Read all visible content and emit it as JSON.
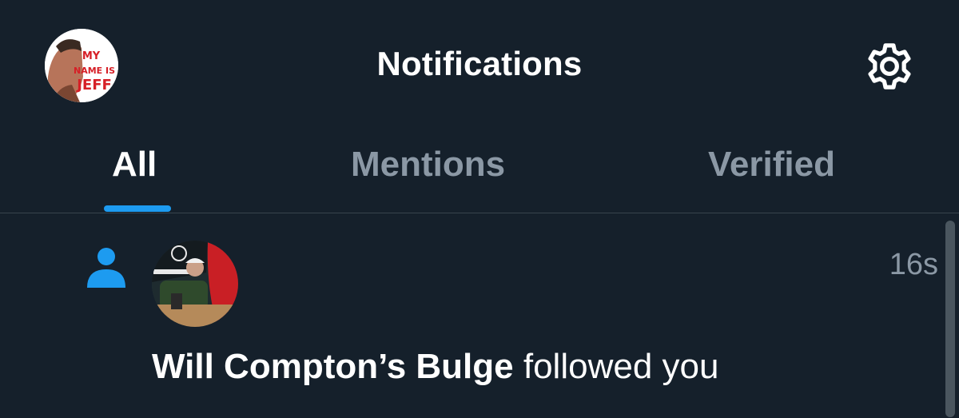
{
  "header": {
    "title": "Notifications",
    "avatar_icon": "profile-avatar",
    "avatar_text": [
      "MY",
      "NAME IS",
      "JEFF"
    ],
    "settings_icon": "gear-icon"
  },
  "tabs": [
    {
      "label": "All",
      "active": true
    },
    {
      "label": "Mentions",
      "active": false
    },
    {
      "label": "Verified",
      "active": false
    }
  ],
  "notifications": [
    {
      "type_icon": "person-icon",
      "user_name": "Will Compton’s Bulge",
      "action": "followed you",
      "time": "16s"
    }
  ],
  "colors": {
    "background": "#15202b",
    "accent": "#1d9bf0",
    "muted_text": "#8b98a5",
    "divider": "#38444d"
  }
}
